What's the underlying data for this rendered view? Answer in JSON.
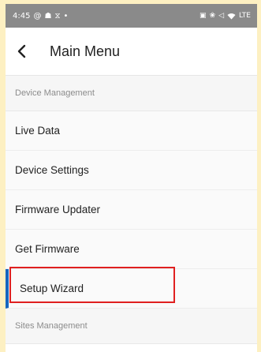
{
  "status_bar": {
    "time": "4:45",
    "left_icons": [
      "@",
      "☗",
      "⧖"
    ],
    "dot": "•",
    "right_icons": [
      "▣",
      "❀",
      "◁"
    ],
    "network": "LTE"
  },
  "app_bar": {
    "title": "Main Menu"
  },
  "menu": {
    "device_management_header": "Device Management",
    "items": [
      {
        "label": "Live Data"
      },
      {
        "label": "Device Settings"
      },
      {
        "label": "Firmware Updater"
      },
      {
        "label": "Get Firmware"
      },
      {
        "label": "Setup Wizard"
      }
    ],
    "sites_management_header": "Sites Management"
  },
  "colors": {
    "page_bg": "#fdf0c2",
    "status_bar_bg": "#8a8a8a",
    "active_indicator": "#1565c0",
    "highlight": "#e02020"
  }
}
